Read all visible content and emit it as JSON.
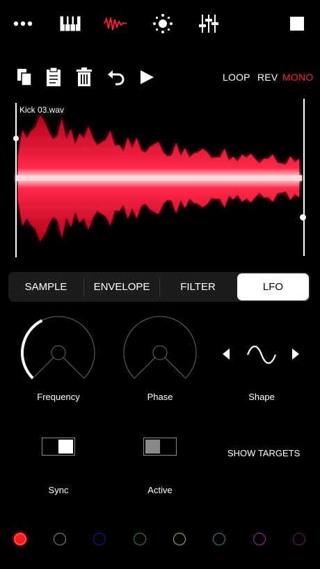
{
  "top_nav": {
    "icons": [
      "more-icon",
      "keyboard-icon",
      "waveform-icon",
      "settings-icon",
      "mixer-icon",
      "stop-icon"
    ],
    "active": "waveform-icon"
  },
  "toolbar": {
    "icons": [
      "copy-icon",
      "paste-icon",
      "delete-icon",
      "undo-icon",
      "play-icon"
    ],
    "loop_label": "LOOP",
    "rev_label": "REV",
    "mono_label": "MONO",
    "mono_active_color": "#ff1e2d"
  },
  "waveform": {
    "file_name": "Kick 03.wav",
    "color": "#ff2040"
  },
  "tabs": {
    "items": [
      "SAMPLE",
      "ENVELOPE",
      "FILTER",
      "LFO"
    ],
    "selected": "LFO"
  },
  "lfo": {
    "frequency_label": "Frequency",
    "frequency_level": 0.4,
    "phase_label": "Phase",
    "phase_level": 0,
    "shape_label": "Shape",
    "shape_value": "sine",
    "sync_label": "Sync",
    "sync_on": true,
    "active_label": "Active",
    "active_on": false,
    "show_targets_label": "SHOW TARGETS"
  },
  "colors": {
    "accent": "#ff1e2d",
    "palette": [
      "#ff1a1a",
      "#888888",
      "#1a1aa8",
      "#2e8a44",
      "#bdb14a",
      "#2f8f8f",
      "#9c2aa8",
      "#6a1a6a"
    ],
    "selected_index": 0
  }
}
